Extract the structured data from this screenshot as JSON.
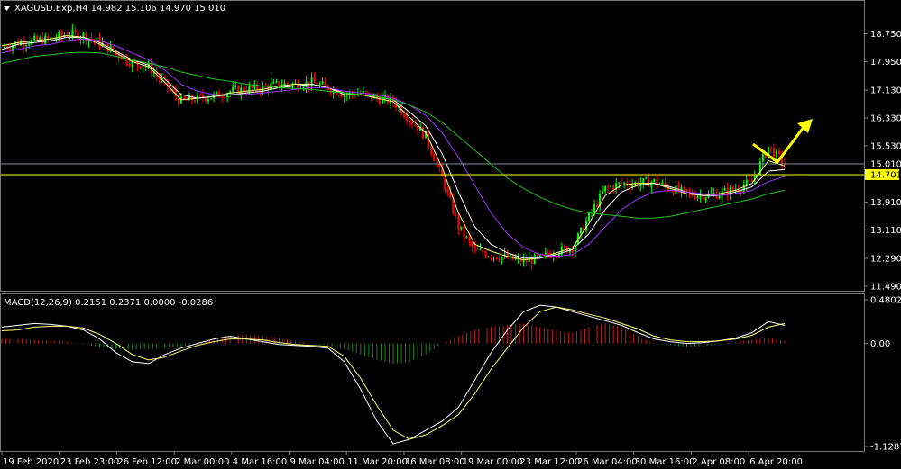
{
  "window": {
    "symbol_header": "XAGUSD.Exp,H4  14.982 15.106 14.970 15.010",
    "macd_header": "MACD(12,26,9) 0.2151 0.2371 0.0000 -0.0286"
  },
  "colors": {
    "background": "#000000",
    "bull": "#00ff00",
    "bear": "#ff0000",
    "ma_fast": "#ffff80",
    "ma_mid": "#ffffff",
    "ma_slow": "#a030ff",
    "ma_long": "#20c020",
    "level": "#ffff00",
    "bid": "#8090a0",
    "macd_pos": "#c02020",
    "macd_neg": "#208020",
    "macd_line": "#ffffff",
    "signal_line": "#ffff80",
    "arrow": "#ffff00"
  },
  "chart_data": [
    {
      "type": "line",
      "panel": "price",
      "ylim": [
        11.49,
        19.1
      ],
      "y_ticks": [
        "18.750",
        "17.950",
        "17.130",
        "16.330",
        "15.530",
        "14.701",
        "13.910",
        "13.110",
        "12.290",
        "11.490"
      ],
      "price_labels": [
        "15.010",
        "14.701"
      ],
      "x_ticks": [
        "19 Feb 2020",
        "23 Feb 23:00",
        "26 Feb 12:00",
        "2 Mar 00:00",
        "4 Mar 16:00",
        "9 Mar 04:00",
        "11 Mar 20:00",
        "16 Mar 08:00",
        "19 Mar 00:00",
        "23 Mar 12:00",
        "26 Mar 04:00",
        "30 Mar 16:00",
        "2 Apr 08:00",
        "6 Apr 20:00"
      ],
      "close_trajectory": [
        18.35,
        18.5,
        18.55,
        18.6,
        18.75,
        18.7,
        18.5,
        18.2,
        17.9,
        17.8,
        17.3,
        16.8,
        16.9,
        16.95,
        17.1,
        17.15,
        17.2,
        17.3,
        17.3,
        17.35,
        17.2,
        17.0,
        17.05,
        16.9,
        16.8,
        16.3,
        15.8,
        14.6,
        13.2,
        12.5,
        12.4,
        12.3,
        12.2,
        12.3,
        12.5,
        12.6,
        13.5,
        14.3,
        14.45,
        14.45,
        14.5,
        14.3,
        14.15,
        14.1,
        14.15,
        14.3,
        14.5,
        15.5,
        15.01
      ],
      "series": [
        {
          "values": [
            18.4,
            18.5,
            18.55,
            18.6,
            18.7,
            18.65,
            18.45,
            18.2,
            17.95,
            17.8,
            17.35,
            16.85,
            16.9,
            16.95,
            17.05,
            17.1,
            17.15,
            17.25,
            17.3,
            17.3,
            17.2,
            17.0,
            17.0,
            16.9,
            16.8,
            16.35,
            15.9,
            14.9,
            13.6,
            12.7,
            12.5,
            12.35,
            12.25,
            12.3,
            12.45,
            12.6,
            13.3,
            14.1,
            14.4,
            14.45,
            14.45,
            14.3,
            14.15,
            14.1,
            14.15,
            14.25,
            14.45,
            15.1,
            14.95
          ]
        },
        {
          "values": [
            18.3,
            18.45,
            18.5,
            18.55,
            18.65,
            18.65,
            18.5,
            18.25,
            18.0,
            17.85,
            17.45,
            17.0,
            16.9,
            16.95,
            17.0,
            17.05,
            17.1,
            17.2,
            17.25,
            17.3,
            17.2,
            17.05,
            17.0,
            16.95,
            16.85,
            16.5,
            16.1,
            15.3,
            14.2,
            13.2,
            12.7,
            12.45,
            12.3,
            12.3,
            12.4,
            12.55,
            13.0,
            13.7,
            14.2,
            14.4,
            14.45,
            14.35,
            14.2,
            14.1,
            14.1,
            14.2,
            14.35,
            14.8,
            14.85
          ]
        },
        {
          "values": [
            18.2,
            18.3,
            18.4,
            18.45,
            18.55,
            18.6,
            18.55,
            18.4,
            18.2,
            18.0,
            17.7,
            17.3,
            17.1,
            17.0,
            17.0,
            17.0,
            17.05,
            17.1,
            17.15,
            17.2,
            17.2,
            17.1,
            17.05,
            17.0,
            16.9,
            16.7,
            16.4,
            15.9,
            15.2,
            14.4,
            13.6,
            13.0,
            12.6,
            12.4,
            12.35,
            12.4,
            12.7,
            13.2,
            13.7,
            14.0,
            14.2,
            14.25,
            14.2,
            14.15,
            14.1,
            14.15,
            14.25,
            14.5,
            14.65
          ]
        },
        {
          "values": [
            17.9,
            18.0,
            18.1,
            18.15,
            18.2,
            18.22,
            18.2,
            18.1,
            18.0,
            17.9,
            17.8,
            17.65,
            17.55,
            17.45,
            17.38,
            17.3,
            17.25,
            17.2,
            17.18,
            17.15,
            17.1,
            17.05,
            17.0,
            16.95,
            16.85,
            16.7,
            16.5,
            16.2,
            15.8,
            15.4,
            15.0,
            14.6,
            14.3,
            14.05,
            13.85,
            13.7,
            13.6,
            13.55,
            13.5,
            13.45,
            13.45,
            13.5,
            13.6,
            13.7,
            13.8,
            13.9,
            14.0,
            14.15,
            14.25
          ]
        }
      ]
    },
    {
      "type": "bar",
      "panel": "macd",
      "ylim": [
        -1.1287,
        0.4802
      ],
      "y_ticks": [
        "0.4802",
        "0.00",
        "-1.1287"
      ],
      "series": [
        {
          "values": [
            0.05,
            0.05,
            0.04,
            0.03,
            0.02,
            -0.01,
            -0.04,
            -0.06,
            -0.07,
            -0.06,
            -0.05,
            -0.03,
            0.0,
            0.04,
            0.08,
            0.1,
            0.08,
            0.06,
            0.03,
            0.0,
            -0.02,
            -0.06,
            -0.12,
            -0.18,
            -0.22,
            -0.2,
            -0.12,
            0.0,
            0.08,
            0.15,
            0.18,
            0.2,
            0.22,
            0.18,
            0.14,
            0.12,
            0.18,
            0.22,
            0.18,
            0.08,
            0.0,
            -0.02,
            -0.04,
            -0.03,
            -0.01,
            0.02,
            0.04,
            0.06,
            0.03
          ]
        },
        {
          "values": [
            0.18,
            0.2,
            0.22,
            0.21,
            0.19,
            0.15,
            0.05,
            -0.1,
            -0.2,
            -0.22,
            -0.12,
            -0.05,
            0.0,
            0.05,
            0.08,
            0.05,
            0.02,
            -0.01,
            -0.02,
            -0.03,
            -0.05,
            -0.2,
            -0.5,
            -0.85,
            -1.1,
            -1.05,
            -0.95,
            -0.85,
            -0.7,
            -0.4,
            -0.1,
            0.15,
            0.35,
            0.42,
            0.4,
            0.35,
            0.3,
            0.25,
            0.2,
            0.12,
            0.05,
            0.02,
            0.0,
            0.01,
            0.03,
            0.06,
            0.12,
            0.24,
            0.2
          ]
        },
        {
          "values": [
            0.14,
            0.15,
            0.18,
            0.19,
            0.19,
            0.17,
            0.1,
            0.0,
            -0.12,
            -0.18,
            -0.15,
            -0.08,
            -0.02,
            0.02,
            0.05,
            0.05,
            0.04,
            0.01,
            -0.01,
            -0.02,
            -0.03,
            -0.14,
            -0.38,
            -0.68,
            -0.95,
            -1.05,
            -1.0,
            -0.9,
            -0.78,
            -0.55,
            -0.28,
            -0.05,
            0.18,
            0.35,
            0.4,
            0.37,
            0.32,
            0.28,
            0.22,
            0.16,
            0.08,
            0.04,
            0.02,
            0.02,
            0.03,
            0.05,
            0.09,
            0.18,
            0.22
          ]
        }
      ]
    }
  ]
}
